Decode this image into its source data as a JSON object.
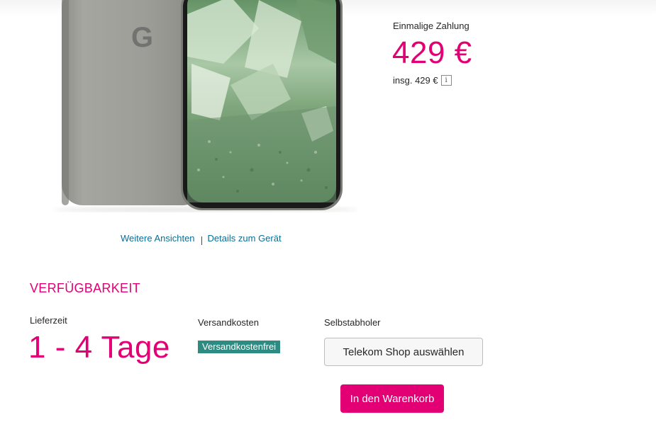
{
  "product": {
    "payment_label": "Einmalige Zahlung",
    "price": "429 €",
    "total_label": "insg. 429 €",
    "info_icon_glyph": "i",
    "brand_logo_letter": "G"
  },
  "links": {
    "more_views": "Weitere Ansichten",
    "device_details": "Details zum Gerät"
  },
  "availability": {
    "title": "VERFÜGBARKEIT",
    "delivery_label": "Lieferzeit",
    "delivery_value": "1 - 4 Tage",
    "shipping_label": "Versandkosten",
    "shipping_badge": "Versandkostenfrei",
    "pickup_label": "Selbstabholer",
    "shop_button": "Telekom Shop auswählen"
  },
  "actions": {
    "cart_button": "In den Warenkorb"
  },
  "colors": {
    "accent": "#e20074",
    "link": "#0a6e94",
    "badge": "#2e8b82"
  },
  "icons": [
    "info-icon",
    "google-logo-icon"
  ]
}
